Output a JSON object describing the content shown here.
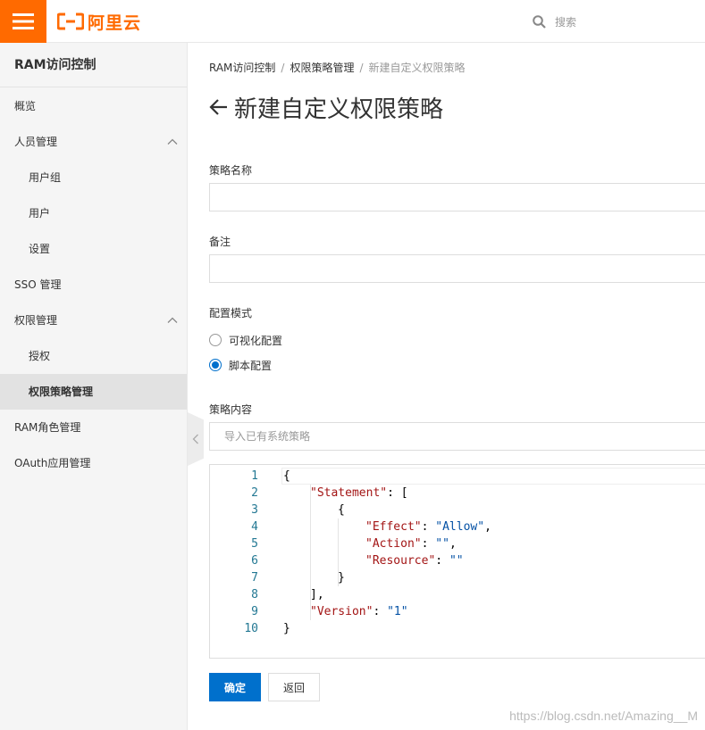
{
  "header": {
    "logo_text": "阿里云",
    "search_placeholder": "搜索"
  },
  "sidebar": {
    "title": "RAM访问控制",
    "items": [
      {
        "label": "概览"
      },
      {
        "label": "人员管理"
      },
      {
        "label": "用户组"
      },
      {
        "label": "用户"
      },
      {
        "label": "设置"
      },
      {
        "label": "SSO 管理"
      },
      {
        "label": "权限管理"
      },
      {
        "label": "授权"
      },
      {
        "label": "权限策略管理"
      },
      {
        "label": "RAM角色管理"
      },
      {
        "label": "OAuth应用管理"
      }
    ]
  },
  "breadcrumb": {
    "items": [
      "RAM访问控制",
      "权限策略管理",
      "新建自定义权限策略"
    ],
    "separator": "/"
  },
  "page": {
    "title": "新建自定义权限策略"
  },
  "form": {
    "policy_name_label": "策略名称",
    "policy_name_value": "",
    "remark_label": "备注",
    "remark_value": "",
    "mode_label": "配置模式",
    "mode_options": [
      "可视化配置",
      "脚本配置"
    ],
    "mode_selected": "脚本配置",
    "content_label": "策略内容",
    "import_placeholder": "导入已有系统策略"
  },
  "editor": {
    "line_numbers": [
      "1",
      "2",
      "3",
      "4",
      "5",
      "6",
      "7",
      "8",
      "9",
      "10"
    ],
    "lines": [
      "{",
      "\"Statement\": [",
      "{",
      "\"Effect\": \"Allow\",",
      "\"Action\": \"\",",
      "\"Resource\": \"\"",
      "}",
      "],",
      "\"Version\": \"1\"",
      "}"
    ]
  },
  "buttons": {
    "confirm": "确定",
    "back": "返回"
  },
  "watermark": "https://blog.csdn.net/Amazing__M",
  "colors": {
    "brand": "#ff6a00",
    "primary": "#0070cc",
    "json_key": "#a31515",
    "json_string": "#0451a5",
    "line_number": "#237893"
  }
}
